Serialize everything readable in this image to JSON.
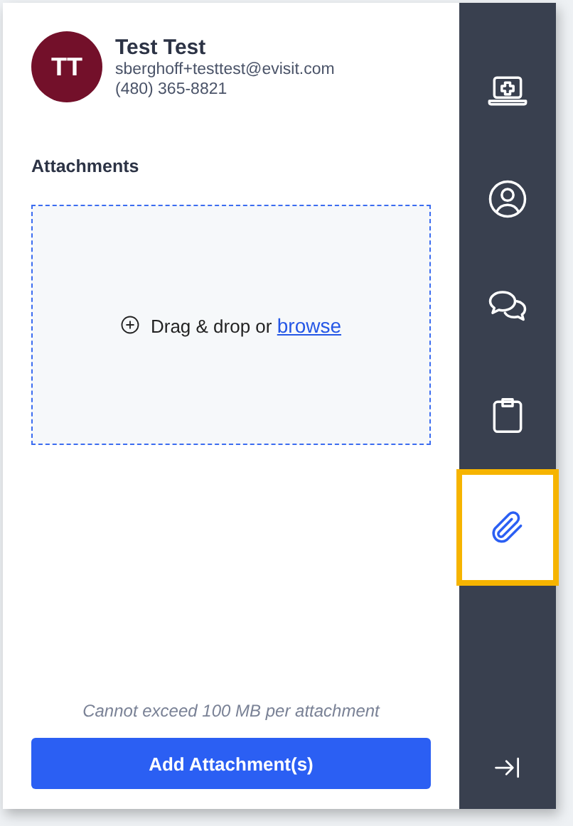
{
  "profile": {
    "initials": "TT",
    "name": "Test Test",
    "email": "sberghoff+testtest@evisit.com",
    "phone": "(480) 365-8821"
  },
  "attachments": {
    "title": "Attachments",
    "dropzone": {
      "text": "Drag & drop or",
      "link": "browse"
    },
    "note": "Cannot exceed 100 MB per attachment",
    "button": "Add Attachment(s)"
  },
  "sidebar": {
    "items": [
      {
        "kind": "visit",
        "selected": false
      },
      {
        "kind": "profile",
        "selected": false
      },
      {
        "kind": "chat",
        "selected": false
      },
      {
        "kind": "clipboard",
        "selected": false
      },
      {
        "kind": "attachment",
        "selected": true
      }
    ],
    "collapse": {
      "kind": "collapse"
    }
  }
}
